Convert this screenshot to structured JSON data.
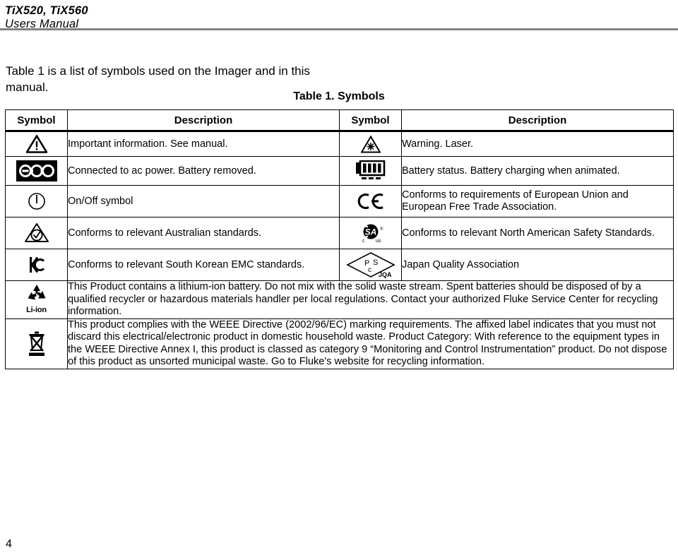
{
  "header": {
    "title": "TiX520, TiX560",
    "subtitle": "Users Manual"
  },
  "intro": {
    "text": "Table 1 is a list of symbols used on the Imager and in this manual."
  },
  "table": {
    "caption": "Table 1. Symbols",
    "columns": [
      "Symbol",
      "Description",
      "Symbol",
      "Description"
    ],
    "rows": [
      {
        "left_icon": "warning-triangle-icon",
        "left_desc": "Important information. See manual.",
        "right_icon": "laser-warning-icon",
        "right_desc": "Warning. Laser."
      },
      {
        "left_icon": "ac-power-connected-icon",
        "left_desc": "Connected to ac power. Battery removed.",
        "right_icon": "battery-status-icon",
        "right_desc": "Battery status. Battery charging when animated."
      },
      {
        "left_icon": "on-off-symbol-icon",
        "left_desc": "On/Off symbol",
        "right_icon": "ce-mark-icon",
        "right_desc": "Conforms to requirements of European Union and European Free Trade Association."
      },
      {
        "left_icon": "rcm-australia-icon",
        "left_desc": "Conforms to relevant Australian standards.",
        "right_icon": "csa-mark-icon",
        "right_desc": "Conforms to relevant North American Safety Standards."
      },
      {
        "left_icon": "kc-korea-icon",
        "left_desc": "Conforms to relevant South Korean EMC standards.",
        "right_icon": "psc-jqa-icon",
        "right_desc": "Japan Quality Association"
      }
    ],
    "full_rows": [
      {
        "icon": "li-ion-recycle-icon",
        "icon_label": "Li-ion",
        "text": "This Product contains a lithium-ion battery. Do not mix with the solid waste stream. Spent batteries should be disposed of by a qualified recycler or hazardous materials handler per local regulations. Contact your authorized Fluke Service Center for recycling information."
      },
      {
        "icon": "weee-crossed-bin-icon",
        "icon_label": "",
        "text": "This product complies with the WEEE Directive (2002/96/EC) marking requirements. The affixed label indicates that you must not discard this electrical/electronic product in domestic household waste. Product Category: With reference to the equipment types in the WEEE Directive Annex I, this product is classed as category 9 “Monitoring and Control Instrumentation” product. Do not dispose of this product as unsorted municipal waste. Go to Fluke's website for recycling information."
      }
    ]
  },
  "footer": {
    "page_number": "4"
  },
  "colors": {
    "text": "#000000",
    "rule": "#808080",
    "border": "#000000",
    "background": "#ffffff"
  }
}
